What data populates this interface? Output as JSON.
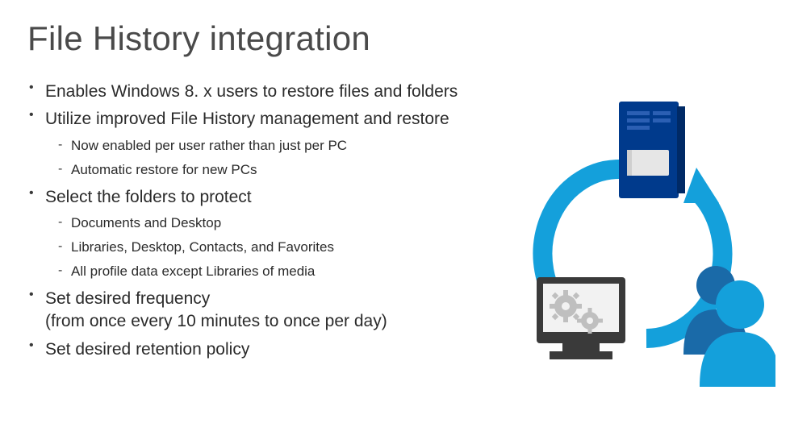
{
  "title": "File History integration",
  "bullets": {
    "b1": "Enables Windows 8. x users to restore files and folders",
    "b2": "Utilize improved File History management and restore",
    "b2s": {
      "a": "Now enabled per user rather than just per PC",
      "b": "Automatic restore for new PCs"
    },
    "b3": "Select the folders to protect",
    "b3s": {
      "a": "Documents and Desktop",
      "b": "Libraries, Desktop, Contacts, and Favorites",
      "c": "All profile data except Libraries of media"
    },
    "b4": "Set desired frequency\n(from once every 10 minutes to once per day)",
    "b5": "Set desired retention policy"
  }
}
